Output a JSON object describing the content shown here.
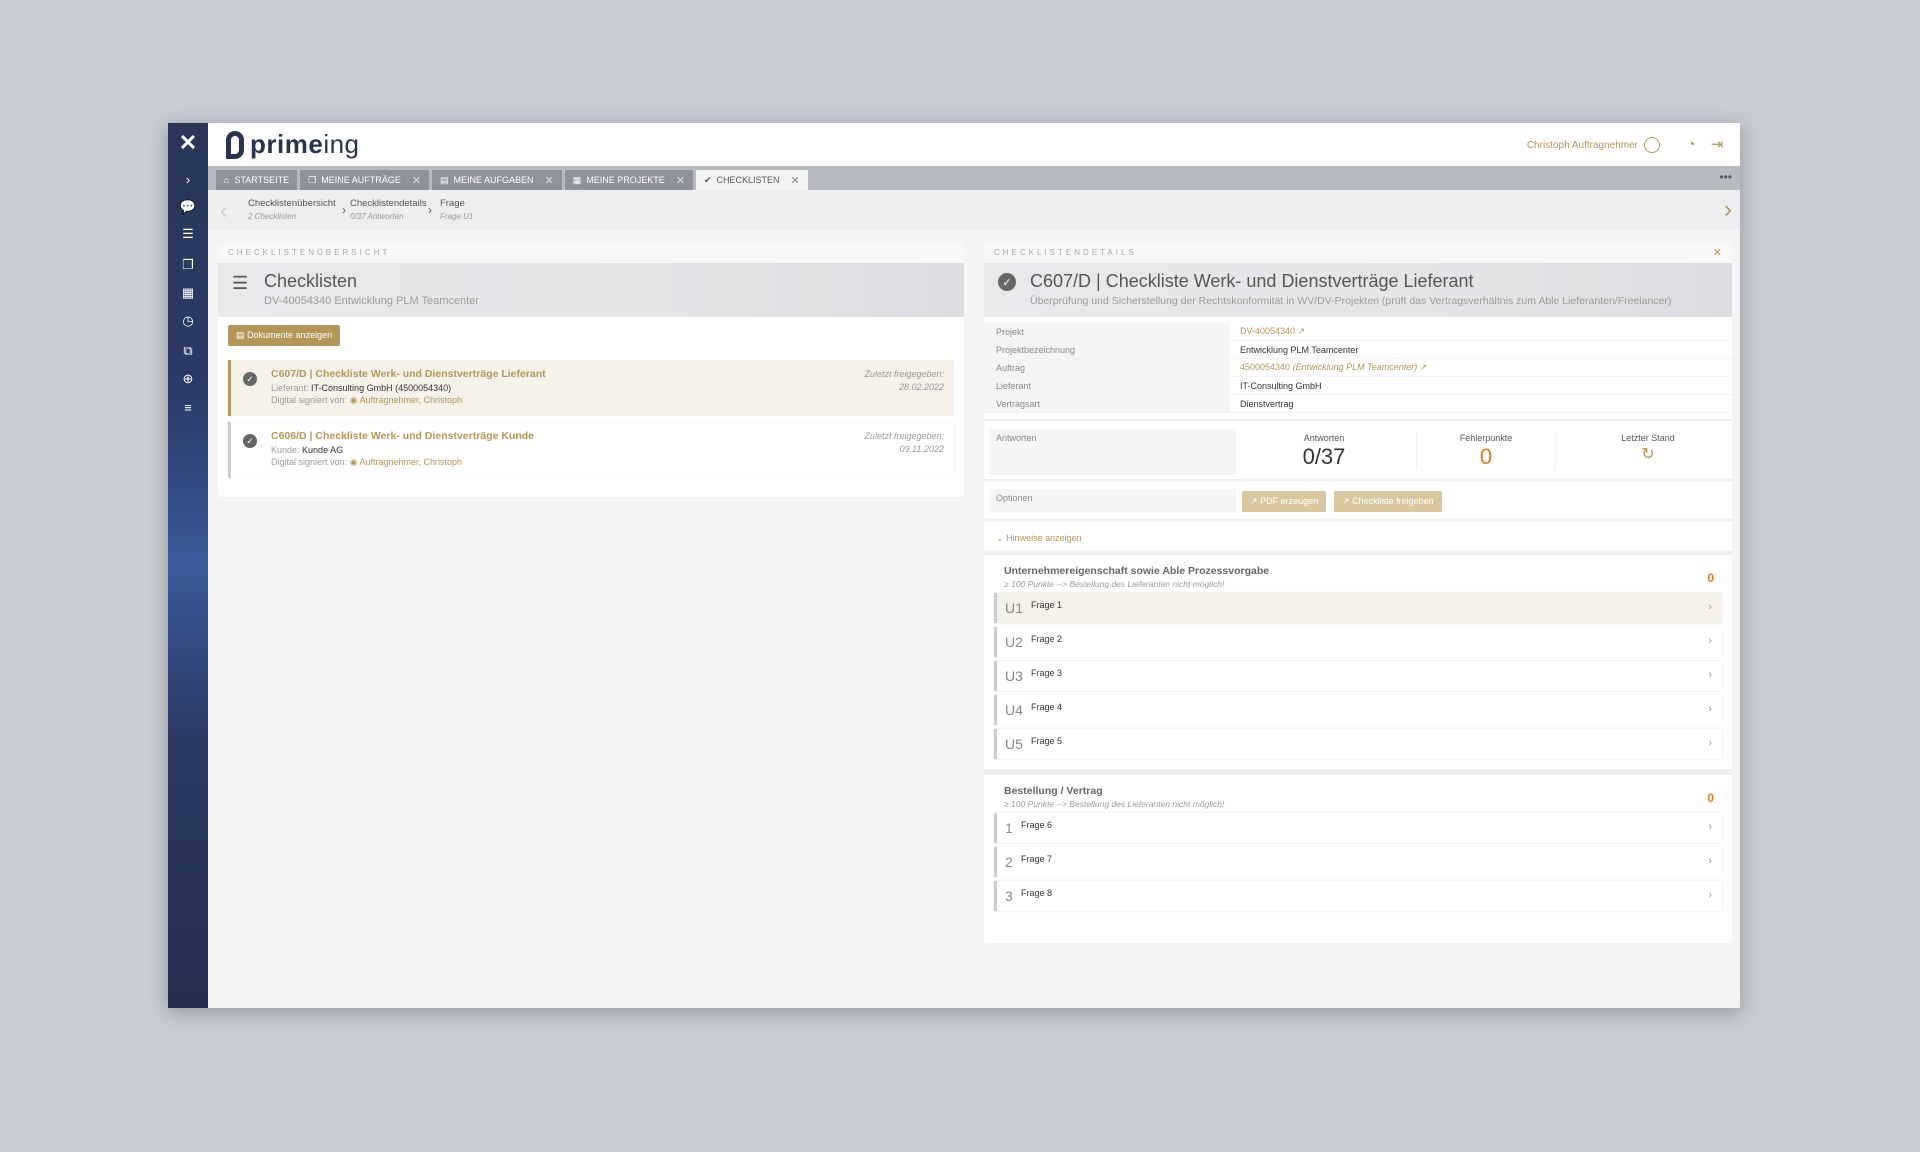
{
  "app": {
    "brand": {
      "prime": "prime",
      "ing": "ing"
    },
    "user_name": "Christoph Auftragnehmer"
  },
  "tabs": [
    {
      "label": "STARTSEITE",
      "icon": "home-icon",
      "closable": false
    },
    {
      "label": "MEINE AUFTRÄGE",
      "icon": "copy-icon",
      "closable": true
    },
    {
      "label": "MEINE AUFGABEN",
      "icon": "list-icon",
      "closable": true
    },
    {
      "label": "MEINE PROJEKTE",
      "icon": "grid-icon",
      "closable": true
    },
    {
      "label": "CHECKLISTEN",
      "icon": "check-circle-icon",
      "closable": true,
      "active": true
    }
  ],
  "breadcrumb": [
    {
      "label": "Checklistenübersicht",
      "sub": "2 Checklisten"
    },
    {
      "label": "Checklistendetails",
      "sub": "0/37 Antworten"
    },
    {
      "label": "Frage",
      "sub": "Frage U1"
    }
  ],
  "left": {
    "tag": "CHECKLISTENÜBERSICHT",
    "title": "Checklisten",
    "subtitle": "DV-40054340 Entwicklung PLM Teamcenter",
    "docs_button": "Dokumente anzeigen",
    "cards": [
      {
        "title": "C607/D | Checkliste Werk- und Dienstverträge Lieferant",
        "line_key": "Lieferant:",
        "line_val": "IT-Consulting GmbH (4500054340)",
        "signed_key": "Digital signiert von:",
        "signed_val": "Auftragnehmer, Christoph",
        "date_label": "Zuletzt freigegeben:",
        "date": "28.02.2022"
      },
      {
        "title": "C606/D | Checkliste Werk- und Dienstverträge Kunde",
        "line_key": "Kunde:",
        "line_val": "Kunde AG",
        "signed_key": "Digital signiert von:",
        "signed_val": "Auftragnehmer, Christoph",
        "date_label": "Zuletzt freigegeben:",
        "date": "09.11.2022"
      }
    ]
  },
  "right": {
    "tag": "CHECKLISTENDETAILS",
    "title": "C607/D | Checkliste Werk- und Dienstverträge Lieferant",
    "subtitle": "Überprüfung und Sicherstellung der Rechtskonformität in WV/DV-Projekten (prüft das Vertragsverhältnis zum Able Lieferanten/Freelancer)",
    "kv": [
      {
        "k": "Projekt",
        "v": "DV-40054340"
      },
      {
        "k": "Projektbezeichnung",
        "v": "Entwicklung PLM Teamcenter"
      },
      {
        "k": "Auftrag",
        "v": "4500054340",
        "v_italic": "(Entwicklung PLM Teamcenter)"
      },
      {
        "k": "Lieferant",
        "v": "IT-Consulting GmbH"
      },
      {
        "k": "Vertragsart",
        "v": "Dienstvertrag"
      }
    ],
    "answers_label": "Antworten",
    "stats": [
      {
        "label": "Antworten",
        "value": "0/37"
      },
      {
        "label": "Fehlerpunkte",
        "value": "0"
      },
      {
        "label": "Letzter Stand",
        "value": "↻"
      }
    ],
    "options_label": "Optionen",
    "pdf_button": "PDF erzeugen",
    "release_button": "Checkliste freigeben",
    "hints_toggle": "Hinweise anzeigen",
    "sections": [
      {
        "title": "Unternehmereigenschaft sowie Able Prozessvorgabe",
        "sub": "≥ 100 Punkte --> Bestellung des Lieferanten nicht möglich!",
        "score": "0",
        "questions": [
          {
            "num": "U1",
            "label": "Frage 1"
          },
          {
            "num": "U2",
            "label": "Frage 2"
          },
          {
            "num": "U3",
            "label": "Frage 3"
          },
          {
            "num": "U4",
            "label": "Frage 4"
          },
          {
            "num": "U5",
            "label": "Frage 5"
          }
        ]
      },
      {
        "title": "Bestellung / Vertrag",
        "sub": "≥ 100 Punkte --> Bestellung des Lieferanten nicht möglich!",
        "score": "0",
        "questions": [
          {
            "num": "1",
            "label": "Frage 6"
          },
          {
            "num": "2",
            "label": "Frage 7"
          },
          {
            "num": "3",
            "label": "Frage 8"
          }
        ]
      }
    ]
  },
  "colors": {
    "accent": "#b39658",
    "rail": "#2a3558",
    "orange": "#e07a1f"
  }
}
